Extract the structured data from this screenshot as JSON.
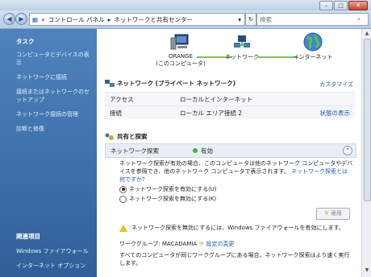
{
  "window": {
    "buttons": [
      "–",
      "□",
      "✕"
    ]
  },
  "address": {
    "crumbs": [
      "«",
      "コントロール パネル",
      "▸",
      "ネットワークと共有センター",
      "▾"
    ],
    "search_placeholder": "検索"
  },
  "sidebar": {
    "heading": "タスク",
    "items": [
      "コンピュータとデバイスの表示",
      "ネットワークに接続",
      "接続またはネットワークのセットアップ",
      "ネットワーク接続の管理",
      "診断と修復"
    ],
    "related_heading": "関連項目",
    "related_items": [
      "Windows ファイアウォール",
      "インターネット オプション"
    ]
  },
  "diagram": {
    "computer_name": "ORANGE",
    "computer_caption": "(このコンピュータ)",
    "network_label": "ネットワーク",
    "internet_label": "インターネット"
  },
  "network": {
    "title": "ネットワーク (プライベート ネットワーク)",
    "customize": "カスタマイズ",
    "rows": [
      {
        "key": "アクセス",
        "value": "ローカルとインターネット",
        "link": ""
      },
      {
        "key": "接続",
        "value": "ローカル エリア接続 2",
        "link": "状態の表示"
      }
    ]
  },
  "sharing": {
    "title": "共有と探索",
    "discovery_label": "ネットワーク探索",
    "discovery_state": "有効",
    "description": "ネットワーク探索が有効の場合、このコンピュータは他のネットワーク コンピュータやデバイスを参照でき、他のネットワーク コンピュータで表示されます。",
    "description_link": "ネットワーク探索とは何ですか?",
    "radio_on": "ネットワーク探索を有効にする(U)",
    "radio_off": "ネットワーク探索を無効にする(K)",
    "apply": "適用",
    "warning": "ネットワーク探索を無効にするには、Windows ファイアウォールを有効にします。",
    "workgroup_label": "ワークグループ: MACADAMIA",
    "workgroup_link": "設定の変更",
    "workgroup_desc": "すべてのコンピュータが同じワークグループにある場合、ネットワーク探索はより速く実行します。"
  }
}
